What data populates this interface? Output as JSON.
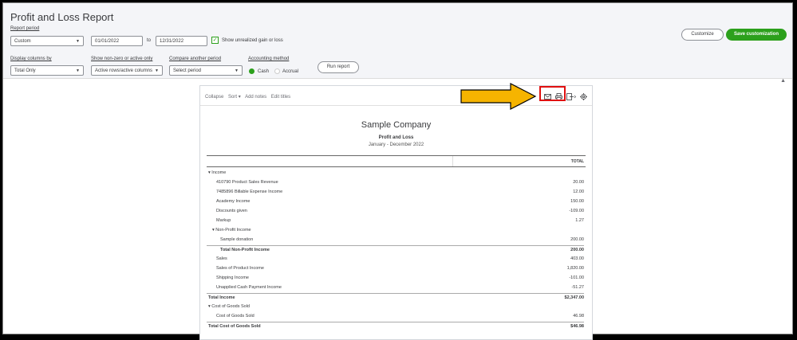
{
  "header": {
    "title": "Profit and Loss Report",
    "report_period_label": "Report period",
    "period_value": "Custom",
    "from_date": "01/01/2022",
    "to_label": "to",
    "to_date": "12/31/2022",
    "unrealized_label": "Show unrealized gain or loss",
    "unrealized_checked": true,
    "display_columns_label": "Display columns by",
    "display_columns_value": "Total Only",
    "nonzero_label": "Show non-zero or active only",
    "nonzero_value": "Active rows/active columns",
    "compare_label": "Compare another period",
    "compare_value": "Select period",
    "accounting_label": "Accounting method",
    "cash_label": "Cash",
    "accrual_label": "Accrual",
    "selected_method": "Cash",
    "run_report": "Run report",
    "customize": "Customize",
    "save_customization": "Save customization",
    "accent": "#2ca01c"
  },
  "report": {
    "toolbar": [
      "Collapse",
      "Sort ▾",
      "Add notes",
      "Edit titles"
    ],
    "company": "Sample Company",
    "title": "Profit and Loss",
    "date_range": "January - December 2022",
    "column_header": "TOTAL",
    "icons": [
      "email-icon",
      "print-icon",
      "export-icon",
      "settings-icon"
    ],
    "rows": [
      {
        "name": "▾ Income",
        "value": "",
        "indent": 0,
        "bold": false,
        "ul": false
      },
      {
        "name": "410790 Product Sales Revenue",
        "value": "20.00",
        "indent": 2,
        "bold": false,
        "ul": false
      },
      {
        "name": "7485896 Billable Expense Income",
        "value": "12.00",
        "indent": 2,
        "bold": false,
        "ul": false
      },
      {
        "name": "Academy Income",
        "value": "150.00",
        "indent": 2,
        "bold": false,
        "ul": false
      },
      {
        "name": "Discounts given",
        "value": "-109.00",
        "indent": 2,
        "bold": false,
        "ul": false
      },
      {
        "name": "Markup",
        "value": "1.27",
        "indent": 2,
        "bold": false,
        "ul": false
      },
      {
        "name": "▾ Non-Profit Income",
        "value": "",
        "indent": 1,
        "bold": false,
        "ul": false
      },
      {
        "name": "Sample donation",
        "value": "200.00",
        "indent": 3,
        "bold": false,
        "ul": false
      },
      {
        "name": "Total Non-Profit Income",
        "value": "200.00",
        "indent": 3,
        "bold": true,
        "ul": true
      },
      {
        "name": "Sales",
        "value": "403.00",
        "indent": 2,
        "bold": false,
        "ul": false
      },
      {
        "name": "Sales of Product Income",
        "value": "1,820.00",
        "indent": 2,
        "bold": false,
        "ul": false
      },
      {
        "name": "Shipping Income",
        "value": "-101.00",
        "indent": 2,
        "bold": false,
        "ul": false
      },
      {
        "name": "Unapplied Cash Payment Income",
        "value": "-51.27",
        "indent": 2,
        "bold": false,
        "ul": false
      },
      {
        "name": "Total Income",
        "value": "$2,347.00",
        "indent": 0,
        "bold": true,
        "ul": true
      },
      {
        "name": "▾ Cost of Goods Sold",
        "value": "",
        "indent": 0,
        "bold": false,
        "ul": false
      },
      {
        "name": "Cost of Goods Sold",
        "value": "46.98",
        "indent": 2,
        "bold": false,
        "ul": false
      },
      {
        "name": "Total Cost of Goods Sold",
        "value": "$46.98",
        "indent": 0,
        "bold": true,
        "ul": true
      }
    ]
  }
}
